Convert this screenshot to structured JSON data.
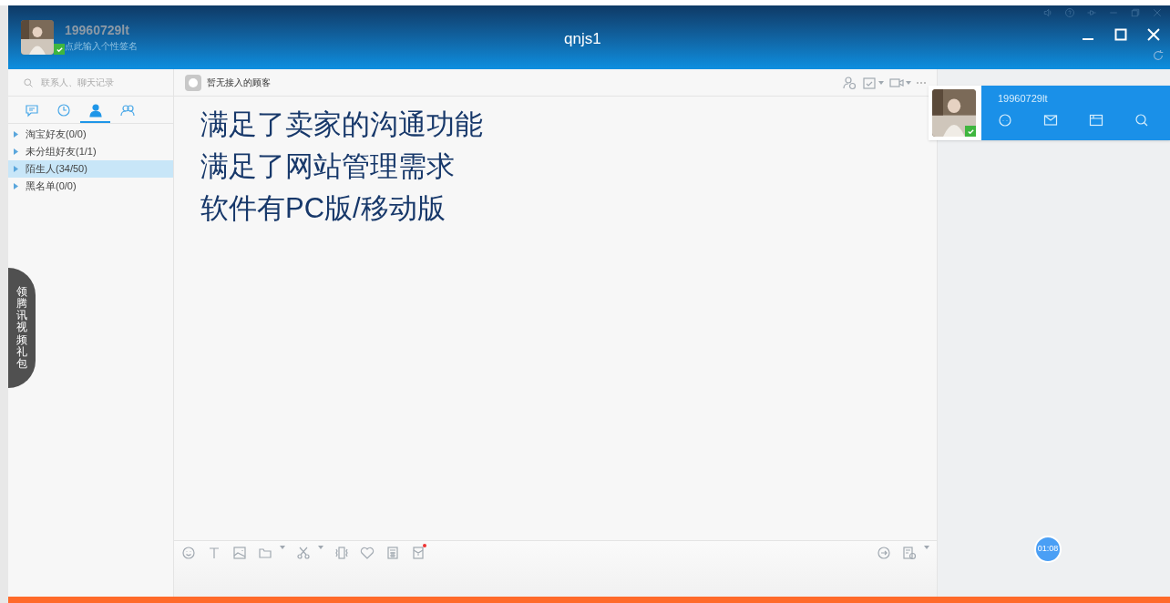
{
  "window": {
    "title": "qnjs1"
  },
  "profile": {
    "username": "19960729lt",
    "signature": "点此输入个性签名",
    "online": true
  },
  "search": {
    "placeholder": "联系人、聊天记录"
  },
  "tabs": [
    {
      "kind": "chat",
      "selected": false
    },
    {
      "kind": "recent",
      "selected": false
    },
    {
      "kind": "contacts",
      "selected": true
    },
    {
      "kind": "groups",
      "selected": false
    }
  ],
  "groups": [
    {
      "label": "淘宝好友(0/0)",
      "selected": false
    },
    {
      "label": "未分组好友(1/1)",
      "selected": false
    },
    {
      "label": "陌生人(34/50)",
      "selected": true
    },
    {
      "label": "黑名单(0/0)",
      "selected": false
    }
  ],
  "side_banner": {
    "text": "领腾讯视频礼包"
  },
  "chat": {
    "status": "暂无接入的顾客",
    "lines": [
      "满足了卖家的沟通功能",
      "满足了网站管理需求",
      "软件有PC版/移动版"
    ]
  },
  "contact_card": {
    "username": "19960729lt",
    "online": true
  },
  "timer": {
    "text": "01:08"
  }
}
